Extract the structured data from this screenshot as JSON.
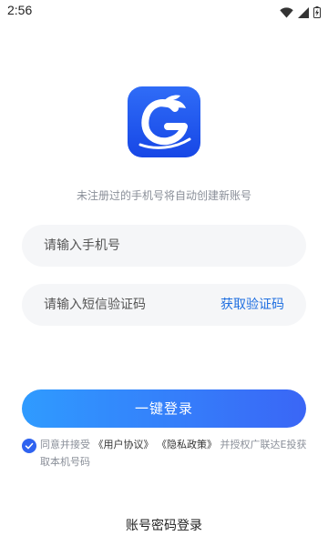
{
  "status_bar": {
    "time": "2:56",
    "icons": [
      "wifi-icon",
      "signal-icon",
      "battery-icon"
    ]
  },
  "logo": {
    "icon": "dragon-g-logo"
  },
  "subtitle": "未注册过的手机号将自动创建新账号",
  "phone_field": {
    "placeholder": "请输入手机号",
    "value": ""
  },
  "code_field": {
    "placeholder": "请输入短信验证码",
    "value": "",
    "get_code_label": "获取验证码"
  },
  "login_button": {
    "label": "一键登录"
  },
  "agreement": {
    "checked": true,
    "prefix": "同意并接受",
    "user_agreement": "《用户协议》",
    "privacy_policy": "《隐私政策》",
    "suffix": "并授权广联达E投获取本机号码"
  },
  "password_login_label": "账号密码登录",
  "colors": {
    "accent": "#1f6fe0",
    "button_gradient_start": "#2f9bff",
    "button_gradient_end": "#3a66f6",
    "field_bg": "#f5f6f8",
    "logo_bg": "#2458ef"
  }
}
